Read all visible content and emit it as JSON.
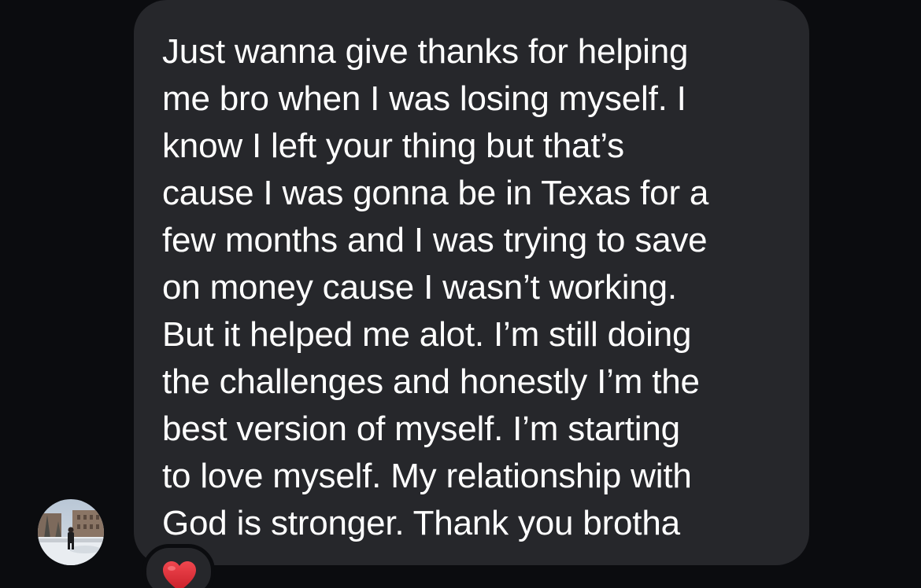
{
  "message": {
    "sender_avatar": "avatar-photo",
    "text": "Just wanna give thanks for helping\nme bro when I was losing myself. I\nknow I left your thing but that’s\ncause I was gonna be in Texas for a\nfew months and I was trying to save\non money cause I wasn’t working.\nBut it helped me alot. I’m still doing\nthe challenges and honestly I’m the\nbest version of myself. I’m starting\nto love myself. My relationship with\nGod is stronger. Thank you brotha",
    "reaction": {
      "icon": "red-heart-icon",
      "color": "#e0252f"
    }
  },
  "colors": {
    "background": "#0b0c0f",
    "bubble": "#26272b",
    "text": "#ffffff"
  }
}
